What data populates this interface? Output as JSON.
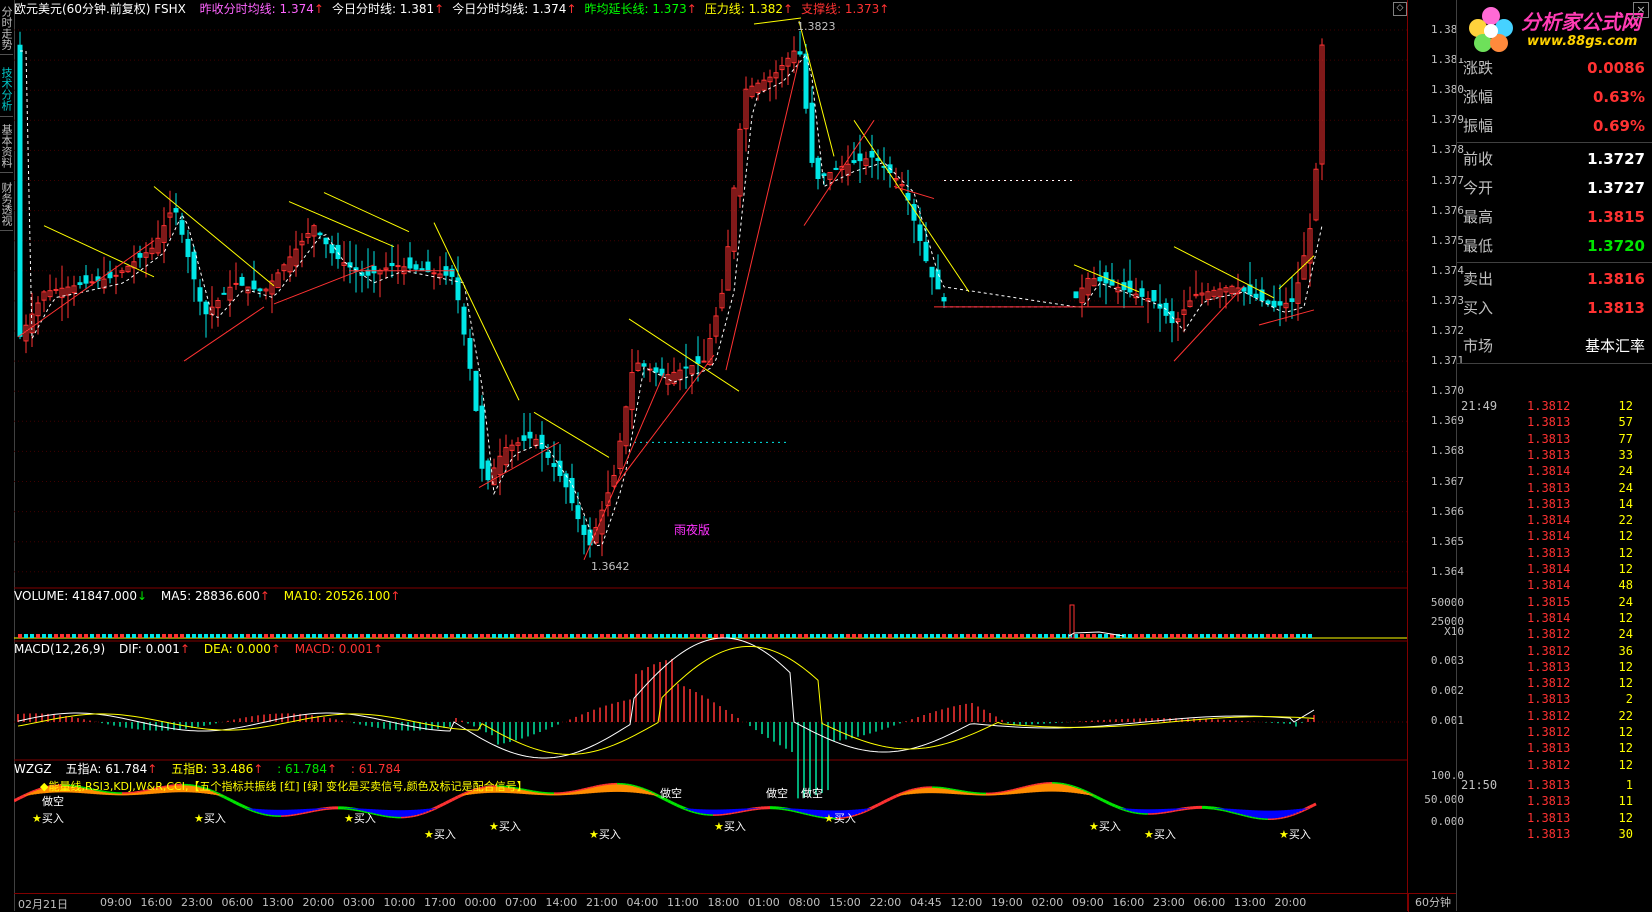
{
  "header": {
    "symbol": "欧元美元(60分钟.前复权) FSHX",
    "items": [
      {
        "label": "昨收分时均线: 1.374",
        "color": "#ff64ff"
      },
      {
        "label": "今日分时线: 1.381",
        "color": "#ffffff"
      },
      {
        "label": "今日分时均线: 1.374",
        "color": "#ffffff"
      },
      {
        "label": "昨均延长线: 1.373",
        "color": "#00ff00"
      },
      {
        "label": "压力线: 1.382",
        "color": "#ffff00"
      },
      {
        "label": "支撑线: 1.373",
        "color": "#ff3232"
      }
    ],
    "arrow": "↑"
  },
  "left_tabs": [
    "分时走势",
    "技术分析",
    "基本资料",
    "财务透视"
  ],
  "price_chart": {
    "high_marker": "1.3823",
    "low_marker": "1.3642",
    "watermark": "雨夜版",
    "y_ticks": [
      "1.382",
      "1.381",
      "1.380",
      "1.379",
      "1.378",
      "1.377",
      "1.376",
      "1.375",
      "1.374",
      "1.373",
      "1.372",
      "1.371",
      "1.370",
      "1.369",
      "1.368",
      "1.367",
      "1.366",
      "1.365",
      "1.364"
    ]
  },
  "volume_panel": {
    "title": "VOLUME: 41847.000",
    "arrow_dn": "↓",
    "ma5": "MA5: 28836.600",
    "ma10": "MA10: 20526.100",
    "arrow_up": "↑",
    "y_ticks": [
      "50000",
      "25000"
    ],
    "scale": "X10"
  },
  "macd_panel": {
    "title": "MACD(12,26,9)",
    "dif": "DIF: 0.001",
    "dea": "DEA: 0.000",
    "macd": "MACD: 0.001",
    "arrow": "↑",
    "y_ticks": [
      "0.003",
      "0.002",
      "0.001",
      "0.000"
    ]
  },
  "wzgz_panel": {
    "title": "WZGZ",
    "a": "五指A: 61.784",
    "b": "五指B: 33.486",
    "c": ": 61.784",
    "d": ": 61.784",
    "arrow": "↑",
    "note": "◆能量线,RSI3,KDJ,W&R,CCI,【五个指标共振线 [红] [绿] 变化是买卖信号,颜色及标记是配合信号】",
    "y_ticks": [
      "100.0",
      "50.000",
      "0.000"
    ],
    "buy_label": "买入",
    "sell_label": "做空"
  },
  "time_axis": {
    "start": "02月21日",
    "labels": [
      "09:00",
      "16:00",
      "23:00",
      "06:00",
      "13:00",
      "20:00",
      "03:00",
      "10:00",
      "17:00",
      "00:00",
      "07:00",
      "14:00",
      "21:00",
      "04:00",
      "11:00",
      "18:00",
      "01:00",
      "08:00",
      "15:00",
      "22:00",
      "04:45",
      "12:00",
      "19:00",
      "02:00",
      "09:00",
      "16:00",
      "23:00",
      "06:00",
      "13:00",
      "20:00"
    ],
    "period": "60分钟"
  },
  "logo": {
    "title": "分析家公式网",
    "url": "www.88gs.com"
  },
  "quote": {
    "rows": [
      {
        "label": "涨跌",
        "value": "0.0086",
        "cls": "up"
      },
      {
        "label": "涨幅",
        "value": "0.63%",
        "cls": "up"
      },
      {
        "label": "振幅",
        "value": "0.69%",
        "cls": "up"
      },
      {
        "label": "前收",
        "value": "1.3727",
        "cls": "wh"
      },
      {
        "label": "今开",
        "value": "1.3727",
        "cls": "wh"
      },
      {
        "label": "最高",
        "value": "1.3815",
        "cls": "up"
      },
      {
        "label": "最低",
        "value": "1.3720",
        "cls": "dn"
      },
      {
        "label": "卖出",
        "value": "1.3816",
        "cls": "up"
      },
      {
        "label": "买入",
        "value": "1.3813",
        "cls": "up"
      }
    ],
    "market_label": "市场",
    "market_value": "基本汇率"
  },
  "ticks": [
    {
      "t": "21:49",
      "p": "1.3812",
      "v": "12"
    },
    {
      "t": "",
      "p": "1.3813",
      "v": "57"
    },
    {
      "t": "",
      "p": "1.3813",
      "v": "77"
    },
    {
      "t": "",
      "p": "1.3813",
      "v": "33"
    },
    {
      "t": "",
      "p": "1.3814",
      "v": "24"
    },
    {
      "t": "",
      "p": "1.3813",
      "v": "24"
    },
    {
      "t": "",
      "p": "1.3813",
      "v": "14"
    },
    {
      "t": "",
      "p": "1.3814",
      "v": "22"
    },
    {
      "t": "",
      "p": "1.3814",
      "v": "12"
    },
    {
      "t": "",
      "p": "1.3813",
      "v": "12"
    },
    {
      "t": "",
      "p": "1.3814",
      "v": "12"
    },
    {
      "t": "",
      "p": "1.3814",
      "v": "48"
    },
    {
      "t": "",
      "p": "1.3815",
      "v": "24"
    },
    {
      "t": "",
      "p": "1.3814",
      "v": "12"
    },
    {
      "t": "",
      "p": "1.3812",
      "v": "24"
    },
    {
      "t": "",
      "p": "1.3812",
      "v": "36"
    },
    {
      "t": "",
      "p": "1.3813",
      "v": "12"
    },
    {
      "t": "",
      "p": "1.3812",
      "v": "12"
    },
    {
      "t": "",
      "p": "1.3813",
      "v": "2"
    },
    {
      "t": "",
      "p": "1.3812",
      "v": "22"
    },
    {
      "t": "",
      "p": "1.3812",
      "v": "12"
    },
    {
      "t": "",
      "p": "1.3813",
      "v": "12"
    },
    {
      "t": "",
      "p": "1.3812",
      "v": "12"
    },
    {
      "t": "21:50",
      "p": "1.3813",
      "v": "1"
    },
    {
      "t": "",
      "p": "1.3813",
      "v": "11"
    },
    {
      "t": "",
      "p": "1.3813",
      "v": "12"
    },
    {
      "t": "",
      "p": "1.3813",
      "v": "30"
    }
  ],
  "colors": {
    "up": "#ff3232",
    "down": "#00e6e6",
    "sep": "#800000"
  }
}
